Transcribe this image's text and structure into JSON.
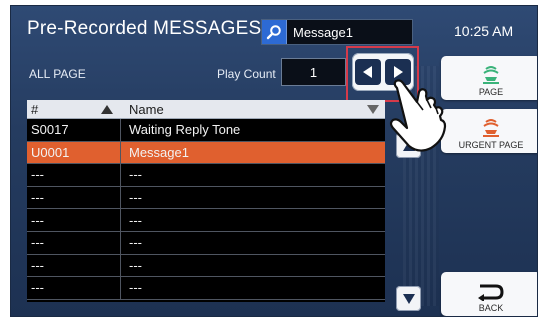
{
  "header": {
    "title": "Pre-Recorded MESSAGES",
    "search_value": "Message1",
    "clock": "10:25 AM"
  },
  "controls": {
    "all_page_label": "ALL PAGE",
    "play_count_label": "Play Count",
    "play_count_value": "1"
  },
  "table": {
    "columns": [
      "#",
      "Name"
    ],
    "rows": [
      {
        "num": "S0017",
        "name": "Waiting Reply Tone",
        "selected": false
      },
      {
        "num": "U0001",
        "name": "Message1",
        "selected": true
      },
      {
        "num": "---",
        "name": "---",
        "selected": false
      },
      {
        "num": "---",
        "name": "---",
        "selected": false
      },
      {
        "num": "---",
        "name": "---",
        "selected": false
      },
      {
        "num": "---",
        "name": "---",
        "selected": false
      },
      {
        "num": "---",
        "name": "---",
        "selected": false
      },
      {
        "num": "---",
        "name": "---",
        "selected": false
      }
    ]
  },
  "side_buttons": {
    "page_label": "PAGE",
    "urgent_page_label": "URGENT PAGE",
    "back_label": "BACK"
  },
  "colors": {
    "background": "#253c60",
    "selected_row": "#e0602f",
    "search_button": "#2d6ad4",
    "page_icon": "#3bb37a",
    "urgent_icon": "#e0602f",
    "highlight_box": "#d63a4a"
  },
  "icons": {
    "search": "search-icon",
    "prev": "triangle-left-icon",
    "next": "triangle-right-icon",
    "scroll_up": "triangle-up-icon",
    "scroll_down": "triangle-down-icon",
    "page": "page-broadcast-icon",
    "urgent": "urgent-broadcast-icon",
    "back": "back-arrow-icon",
    "pointer": "hand-pointer-icon"
  }
}
